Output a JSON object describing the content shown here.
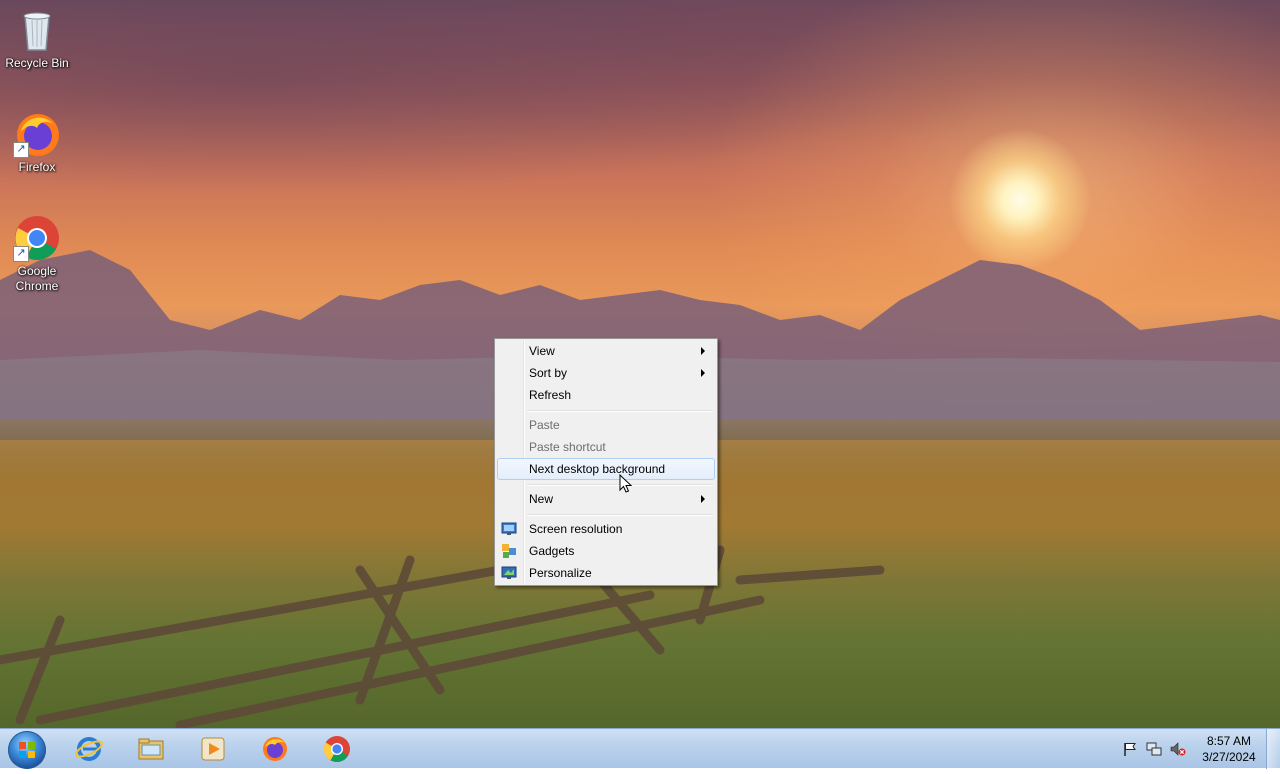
{
  "desktop": {
    "icons": [
      {
        "label": "Recycle Bin",
        "icon": "recycle-bin-icon"
      },
      {
        "label": "Firefox",
        "icon": "firefox-icon"
      },
      {
        "label": "Google Chrome",
        "icon": "chrome-icon"
      }
    ]
  },
  "context_menu": {
    "items": [
      {
        "label": "View",
        "submenu": true,
        "enabled": true
      },
      {
        "label": "Sort by",
        "submenu": true,
        "enabled": true
      },
      {
        "label": "Refresh",
        "enabled": true
      },
      {
        "label": "Paste",
        "enabled": false
      },
      {
        "label": "Paste shortcut",
        "enabled": false
      },
      {
        "label": "Next desktop background",
        "enabled": true,
        "highlighted": true
      },
      {
        "label": "New",
        "submenu": true,
        "enabled": true
      },
      {
        "label": "Screen resolution",
        "icon": "screen-resolution-icon",
        "enabled": true
      },
      {
        "label": "Gadgets",
        "icon": "gadgets-icon",
        "enabled": true
      },
      {
        "label": "Personalize",
        "icon": "personalize-icon",
        "enabled": true
      }
    ]
  },
  "taskbar": {
    "start": "start-orb-icon",
    "pinned": [
      "internet-explorer-icon",
      "windows-explorer-icon",
      "media-player-icon",
      "firefox-icon",
      "chrome-icon"
    ],
    "tray": [
      "action-center-flag-icon",
      "network-icon",
      "volume-muted-icon"
    ],
    "clock": {
      "time": "8:57 AM",
      "date": "3/27/2024"
    }
  },
  "colors": {
    "menu_bg": "#f0f0f0",
    "menu_highlight_border": "#aecff7",
    "taskbar": "#b9d1ec"
  }
}
